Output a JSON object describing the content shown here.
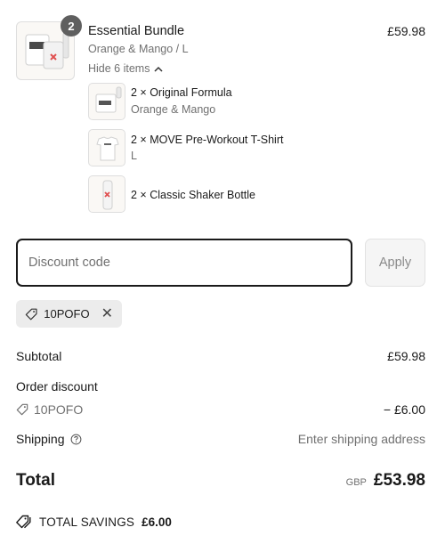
{
  "product": {
    "quantity_badge": "2",
    "title": "Essential Bundle",
    "variant": "Orange & Mango / L",
    "price": "£59.98",
    "hide_label": "Hide 6 items"
  },
  "bundle_items": [
    {
      "label": "2 × Original Formula",
      "variant": "Orange & Mango"
    },
    {
      "label": "2 × MOVE Pre-Workout T-Shirt",
      "variant": "L"
    },
    {
      "label": "2 × Classic Shaker Bottle",
      "variant": ""
    }
  ],
  "discount": {
    "placeholder": "Discount code",
    "apply_label": "Apply",
    "applied_code": "10POFO"
  },
  "summary": {
    "subtotal_label": "Subtotal",
    "subtotal_value": "£59.98",
    "order_discount_label": "Order discount",
    "discount_code": "10POFO",
    "discount_value": "− £6.00",
    "shipping_label": "Shipping",
    "shipping_value": "Enter shipping address",
    "total_label": "Total",
    "currency": "GBP",
    "total_value": "£53.98",
    "savings_label": "TOTAL SAVINGS",
    "savings_value": "£6.00"
  },
  "icons": {
    "tag": "tag-icon",
    "close": "close-icon",
    "help": "help-circle-icon",
    "chevron": "chevron-up-icon",
    "savings": "tags-icon"
  },
  "colors": {
    "text": "#1a1a1a",
    "muted": "#707070",
    "badge": "#5f5f5f",
    "chip_bg": "#ececec"
  }
}
